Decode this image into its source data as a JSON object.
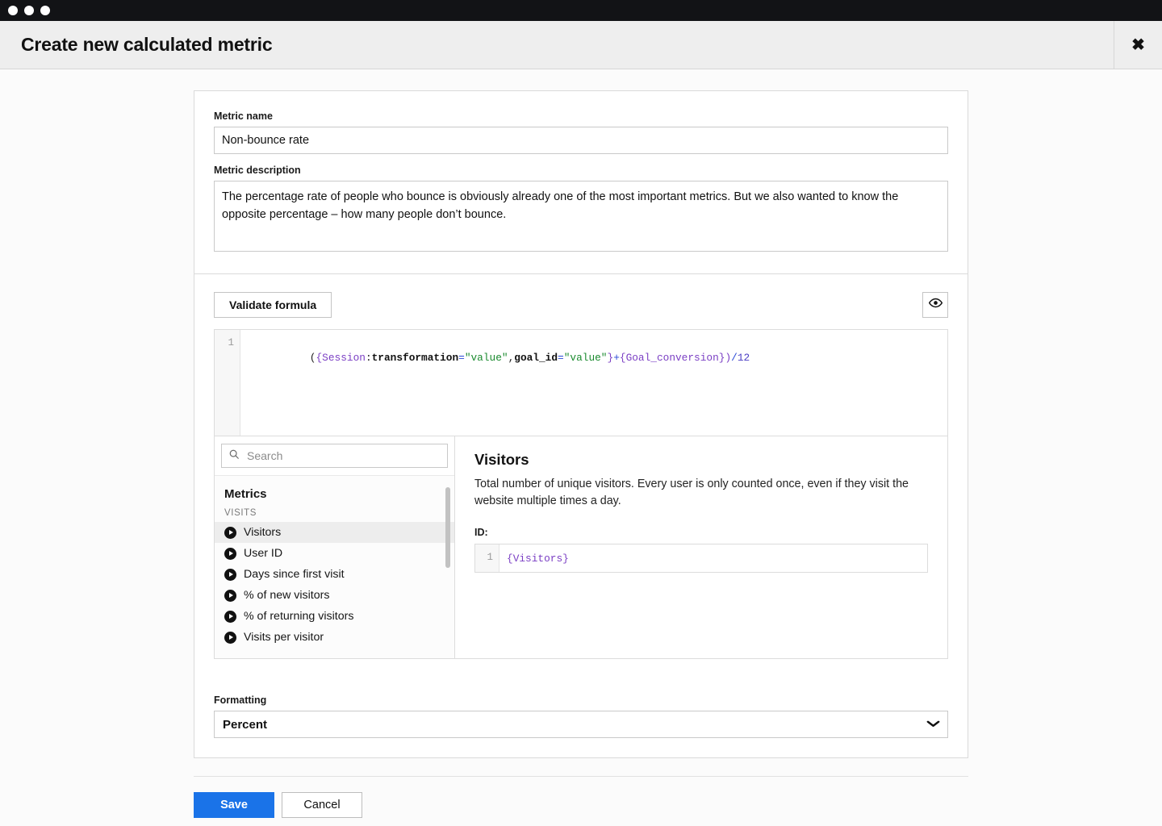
{
  "window": {
    "traffic_lights": [
      "close",
      "minimize",
      "maximize"
    ]
  },
  "header": {
    "title": "Create new calculated metric",
    "close_icon": "close-icon",
    "close_glyph": "✖"
  },
  "form": {
    "name_label": "Metric name",
    "name_value": "Non-bounce rate",
    "name_placeholder": "Metric name",
    "description_label": "Metric description",
    "description_value": "The percentage rate of people who bounce is obviously already one of the most important metrics. But we also wanted to know the opposite percentage – how many people don’t bounce.",
    "description_placeholder": "Metric description"
  },
  "formula": {
    "validate_label": "Validate formula",
    "preview_icon": "eye-icon",
    "line_number": "1",
    "raw": "({Session:transformation=\"value\",goal_id=\"value\"}+{Goal_conversion})/12",
    "tokens": [
      {
        "text": "(",
        "type": "plain"
      },
      {
        "text": "{",
        "type": "brace"
      },
      {
        "text": "Session",
        "type": "id"
      },
      {
        "text": ":",
        "type": "plain"
      },
      {
        "text": "transformation",
        "type": "key"
      },
      {
        "text": "=",
        "type": "op"
      },
      {
        "text": "\"value\"",
        "type": "str"
      },
      {
        "text": ",",
        "type": "plain"
      },
      {
        "text": "goal_id",
        "type": "key"
      },
      {
        "text": "=",
        "type": "op"
      },
      {
        "text": "\"value\"",
        "type": "str"
      },
      {
        "text": "}",
        "type": "brace"
      },
      {
        "text": "+",
        "type": "op"
      },
      {
        "text": "{",
        "type": "brace"
      },
      {
        "text": "Goal_conversion",
        "type": "id"
      },
      {
        "text": "}",
        "type": "brace"
      },
      {
        "text": ")",
        "type": "brace"
      },
      {
        "text": "/",
        "type": "op"
      },
      {
        "text": "12",
        "type": "num"
      }
    ]
  },
  "picker": {
    "search_placeholder": "Search",
    "search_value": "",
    "search_icon": "search-icon",
    "list_heading": "Metrics",
    "group_label": "VISITS",
    "items": [
      {
        "label": "Visitors",
        "selected": true
      },
      {
        "label": "User ID",
        "selected": false
      },
      {
        "label": "Days since first visit",
        "selected": false
      },
      {
        "label": "% of new visitors",
        "selected": false
      },
      {
        "label": "% of returning visitors",
        "selected": false
      },
      {
        "label": "Visits per visitor",
        "selected": false
      }
    ],
    "detail": {
      "title": "Visitors",
      "description": "Total number of unique visitors. Every user is only counted once, even if they visit the website multiple times a day.",
      "id_label": "ID:",
      "id_line_number": "1",
      "id_code_open": "{",
      "id_code_name": "Visitors",
      "id_code_close": "}"
    }
  },
  "formatting": {
    "label": "Formatting",
    "value": "Percent",
    "chevron_icon": "chevron-down-icon",
    "chevron_glyph": "⌄",
    "options": [
      "Percent"
    ]
  },
  "footer": {
    "save_label": "Save",
    "cancel_label": "Cancel"
  },
  "colors": {
    "accent": "#1A73E8",
    "titlebar": "#121316",
    "header_bg": "#EEEEEE",
    "body_bg": "#FBFBFB",
    "token_identifier": "#7B3FC4",
    "token_string": "#1A8A2E",
    "token_operator": "#2A49D6"
  }
}
